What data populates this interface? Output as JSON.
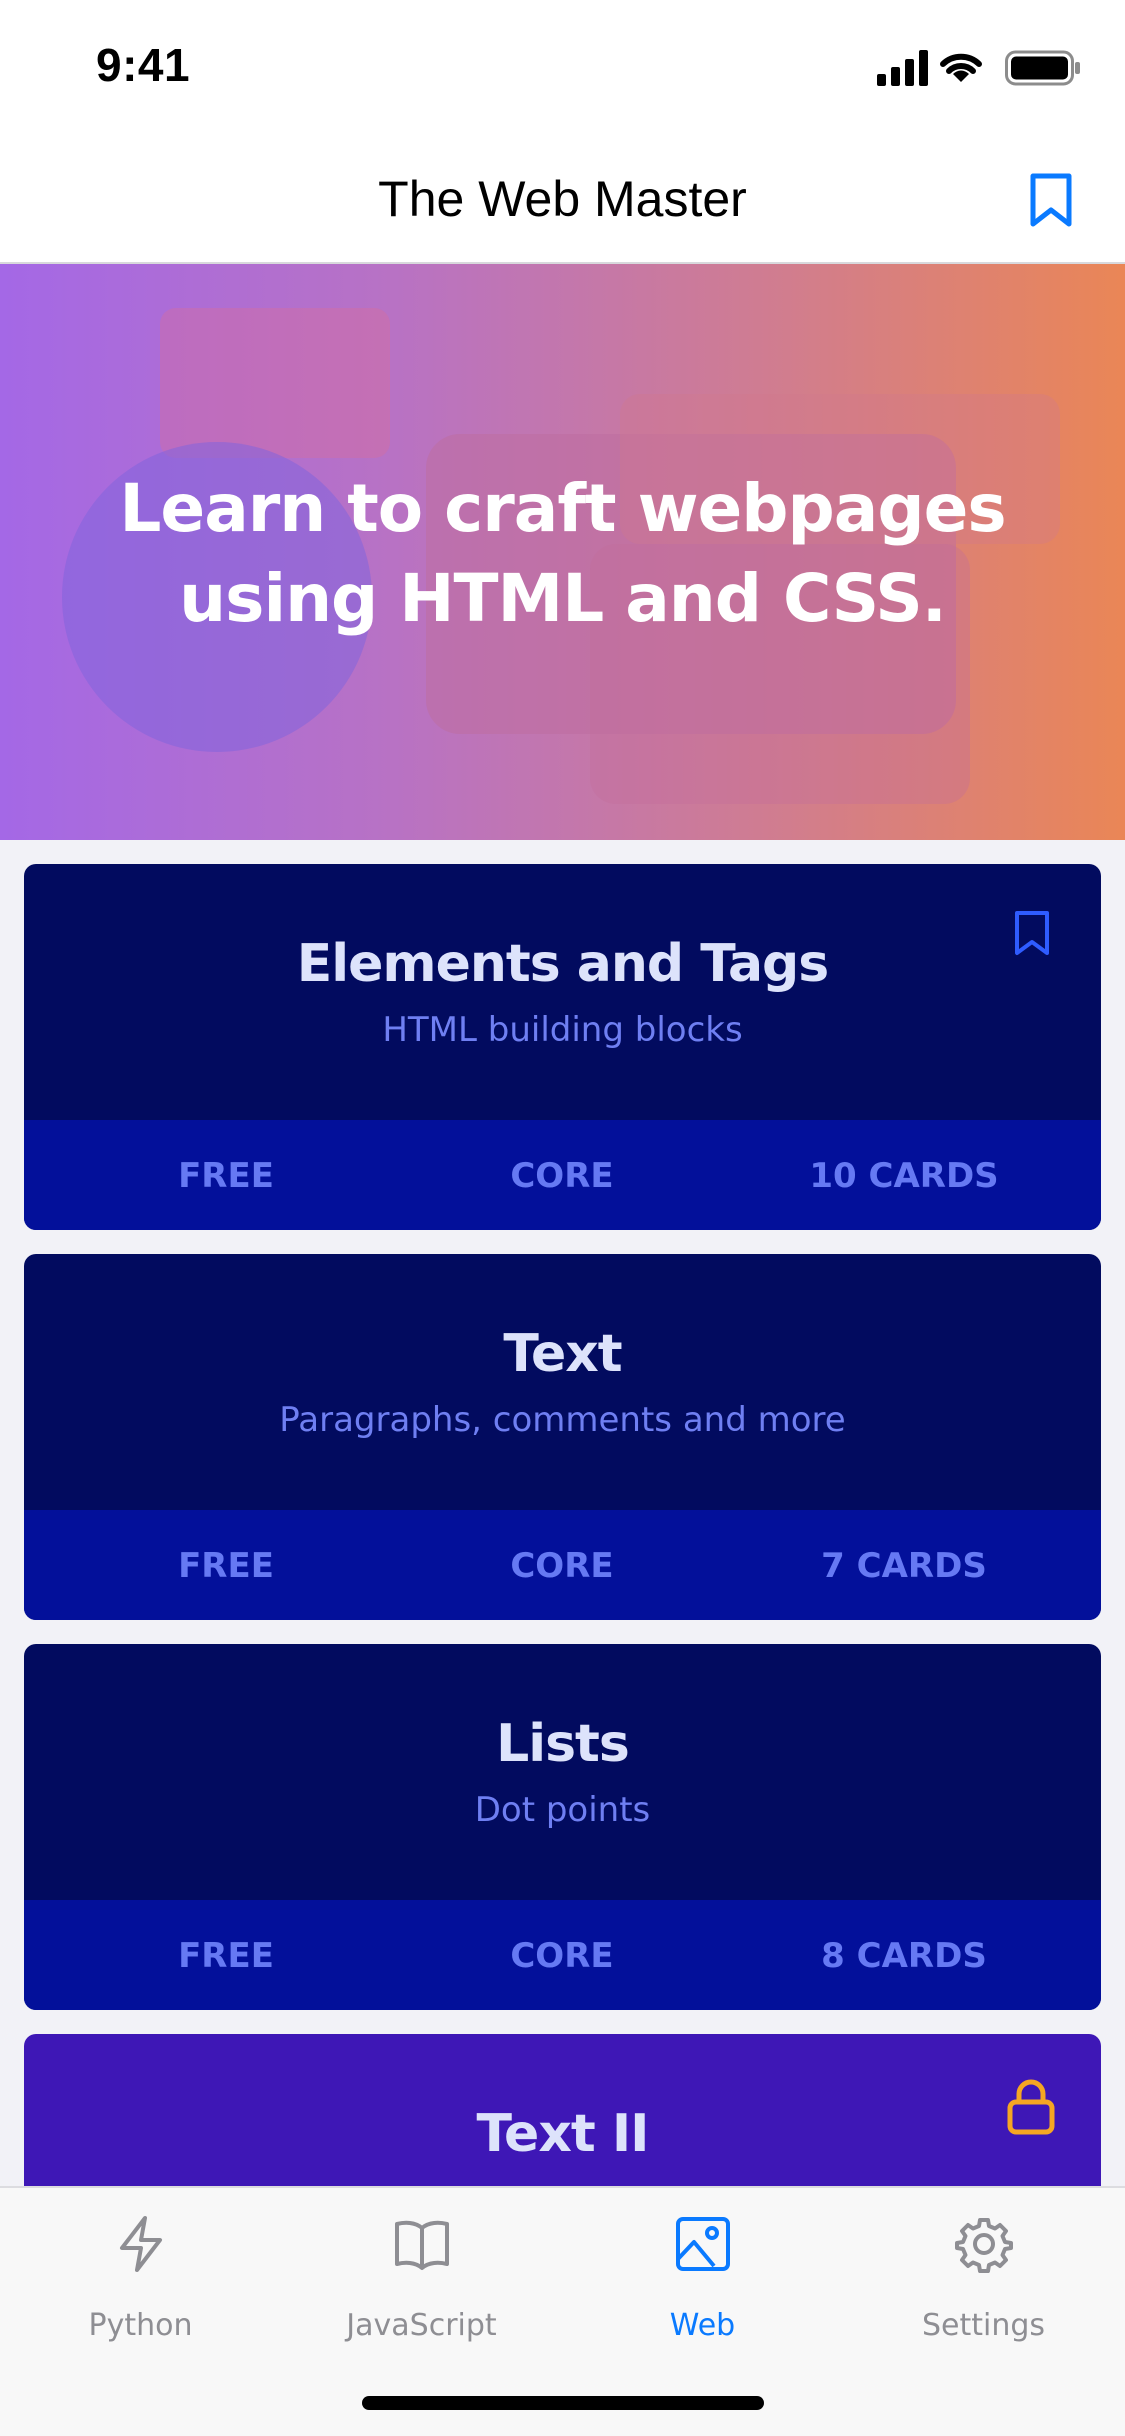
{
  "status_bar": {
    "time": "9:41"
  },
  "nav": {
    "title": "The Web Master",
    "bookmark_icon": "bookmark-icon"
  },
  "hero": {
    "line1": "Learn to craft webpages",
    "line2": "using HTML and CSS."
  },
  "courses": [
    {
      "title": "Elements and Tags",
      "subtitle": "HTML building blocks",
      "price": "FREE",
      "level": "CORE",
      "cards": "10 CARDS",
      "bookmarked": true
    },
    {
      "title": "Text",
      "subtitle": "Paragraphs, comments and more",
      "price": "FREE",
      "level": "CORE",
      "cards": "7 CARDS"
    },
    {
      "title": "Lists",
      "subtitle": "Dot points",
      "price": "FREE",
      "level": "CORE",
      "cards": "8 CARDS"
    },
    {
      "title": "Text II",
      "locked": true
    }
  ],
  "tabs": [
    {
      "label": "Python",
      "icon": "bolt-icon"
    },
    {
      "label": "JavaScript",
      "icon": "book-icon"
    },
    {
      "label": "Web",
      "icon": "image-icon",
      "active": true
    },
    {
      "label": "Settings",
      "icon": "gear-icon"
    }
  ],
  "colors": {
    "accent": "#0a7aff",
    "card_bg": "#020b5f",
    "card_footer": "#03109a",
    "card_locked": "#3e17b6",
    "lock_icon": "#f5a623"
  }
}
